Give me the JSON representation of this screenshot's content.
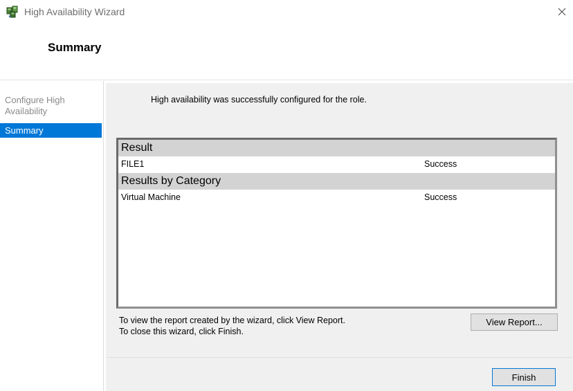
{
  "window": {
    "title": "High Availability Wizard",
    "icon": "cluster-wizard-icon",
    "close_icon": "close-icon"
  },
  "header": {
    "title": "Summary"
  },
  "nav": {
    "items": [
      {
        "label": "Configure High Availability",
        "selected": false
      },
      {
        "label": "Summary",
        "selected": true
      }
    ]
  },
  "main": {
    "message": "High availability was successfully configured for the role.",
    "report": {
      "groups": [
        {
          "title": "Result",
          "rows": [
            {
              "name": "FILE1",
              "status": "Success"
            }
          ]
        },
        {
          "title": "Results by Category",
          "rows": [
            {
              "name": "Virtual Machine",
              "status": "Success"
            }
          ]
        }
      ]
    },
    "hint_line1": "To view the report created by the wizard, click View Report.",
    "hint_line2": "To close this wizard, click Finish.",
    "view_report_label": "View Report..."
  },
  "footer": {
    "finish_label": "Finish"
  },
  "colors": {
    "selection": "#0078d7",
    "panel_bg": "#f0f0f0",
    "group_header_bg": "#d3d3d3"
  }
}
